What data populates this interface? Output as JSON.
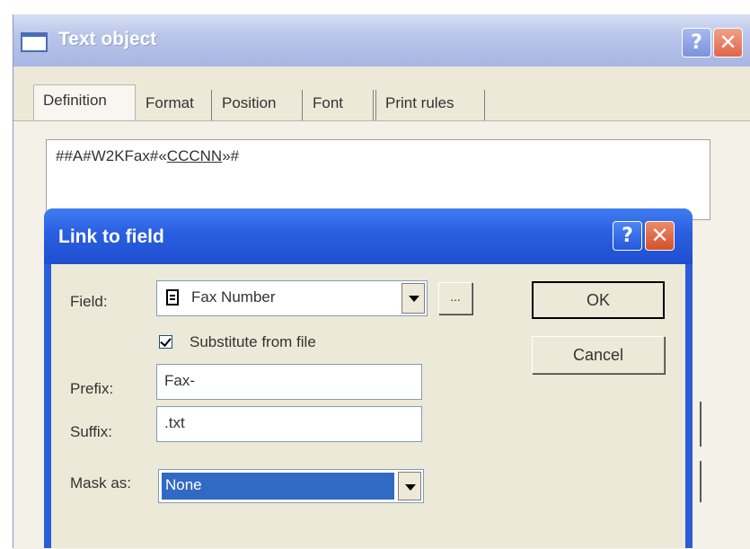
{
  "outer_window": {
    "title": "Text object",
    "help_glyph": "?",
    "close_glyph": "✕",
    "tabs": [
      {
        "label": "Definition",
        "active": true
      },
      {
        "label": "Format",
        "active": false
      },
      {
        "label": "Position",
        "active": false
      },
      {
        "label": "Font",
        "active": false
      },
      {
        "label": "Print rules",
        "active": false
      }
    ],
    "definition_text": {
      "prefix": "##A#W2KFax#«",
      "field": "CCCNN",
      "suffix": "»#"
    }
  },
  "dialog": {
    "title": "Link to field",
    "help_glyph": "?",
    "close_glyph": "✕",
    "field_label": "Field:",
    "field_value": "Fax Number",
    "browse_label": "...",
    "substitute_label": "Substitute from file",
    "substitute_checked": true,
    "prefix_label": "Prefix:",
    "prefix_value": "Fax-",
    "suffix_label": "Suffix:",
    "suffix_value": ".txt",
    "mask_label": "Mask as:",
    "mask_value": "None",
    "ok_label": "OK",
    "cancel_label": "Cancel"
  },
  "colors": {
    "dialog_title": "#2a5ee0",
    "selection": "#316ac5",
    "window_face": "#ece9d8"
  }
}
